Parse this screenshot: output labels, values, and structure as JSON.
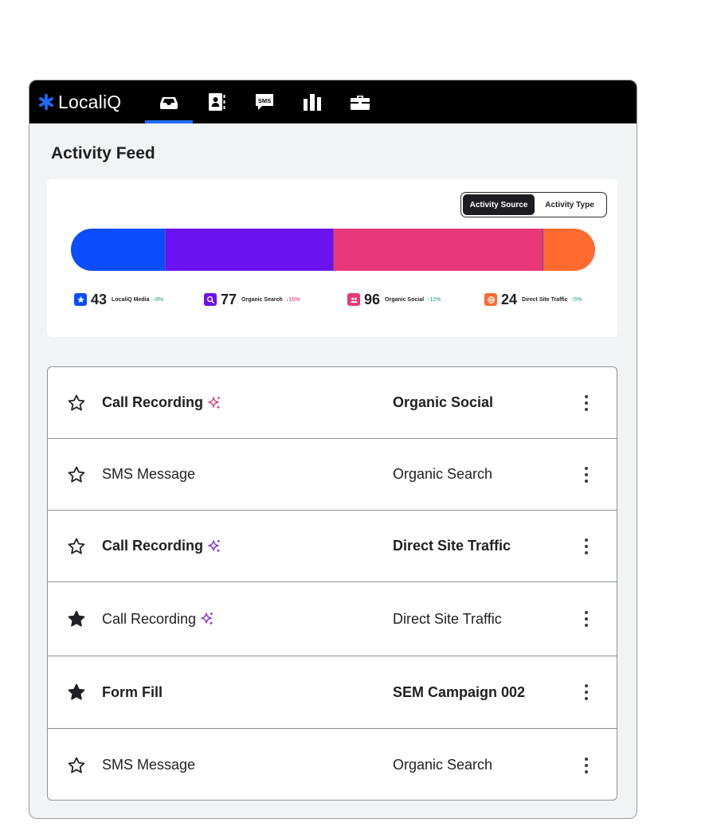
{
  "brand": {
    "name": "LocaliQ"
  },
  "nav": {
    "items": [
      {
        "icon": "inbox-icon",
        "active": true
      },
      {
        "icon": "contacts-icon",
        "active": false
      },
      {
        "icon": "sms-icon",
        "label": "SMS",
        "active": false
      },
      {
        "icon": "bar-chart-icon",
        "active": false
      },
      {
        "icon": "briefcase-icon",
        "active": false
      }
    ]
  },
  "page": {
    "title": "Activity Feed"
  },
  "toggle": {
    "active_label": "Activity Source",
    "inactive_label": "Activity Type"
  },
  "summary": {
    "segments": [
      {
        "name": "LocaliQ Media",
        "count": "43",
        "delta": "↑8%",
        "direction": "up",
        "color": "#0b4dff",
        "icon": "sparkle-badge-icon"
      },
      {
        "name": "Organic Search",
        "count": "77",
        "delta": "↓15%",
        "direction": "down",
        "color": "#6b12f0",
        "icon": "search-icon"
      },
      {
        "name": "Organic Social",
        "count": "96",
        "delta": "↑12%",
        "direction": "up",
        "color": "#e8387a",
        "icon": "people-icon"
      },
      {
        "name": "Direct Site Traffic",
        "count": "24",
        "delta": "↑5%",
        "direction": "up",
        "color": "#ff6a2e",
        "icon": "globe-icon"
      }
    ]
  },
  "feed": {
    "rows": [
      {
        "starred": false,
        "activity": "Call Recording",
        "ai": true,
        "ai_color": "pink",
        "source": "Organic Social",
        "bold": true
      },
      {
        "starred": false,
        "activity": "SMS Message",
        "ai": false,
        "source": "Organic Search",
        "bold": false
      },
      {
        "starred": false,
        "activity": "Call Recording",
        "ai": true,
        "ai_color": "purple",
        "source": "Direct Site Traffic",
        "bold": true
      },
      {
        "starred": true,
        "activity": "Call Recording",
        "ai": true,
        "ai_color": "purple",
        "source": "Direct Site Traffic",
        "bold": false
      },
      {
        "starred": true,
        "activity": "Form Fill",
        "ai": false,
        "source": "SEM Campaign 002",
        "bold": true
      },
      {
        "starred": false,
        "activity": "SMS Message",
        "ai": false,
        "source": "Organic Search",
        "bold": false
      }
    ]
  },
  "colors": {
    "accent": "#1f6bff",
    "topbar": "#000000",
    "brand_mark": "#1f6bff"
  }
}
